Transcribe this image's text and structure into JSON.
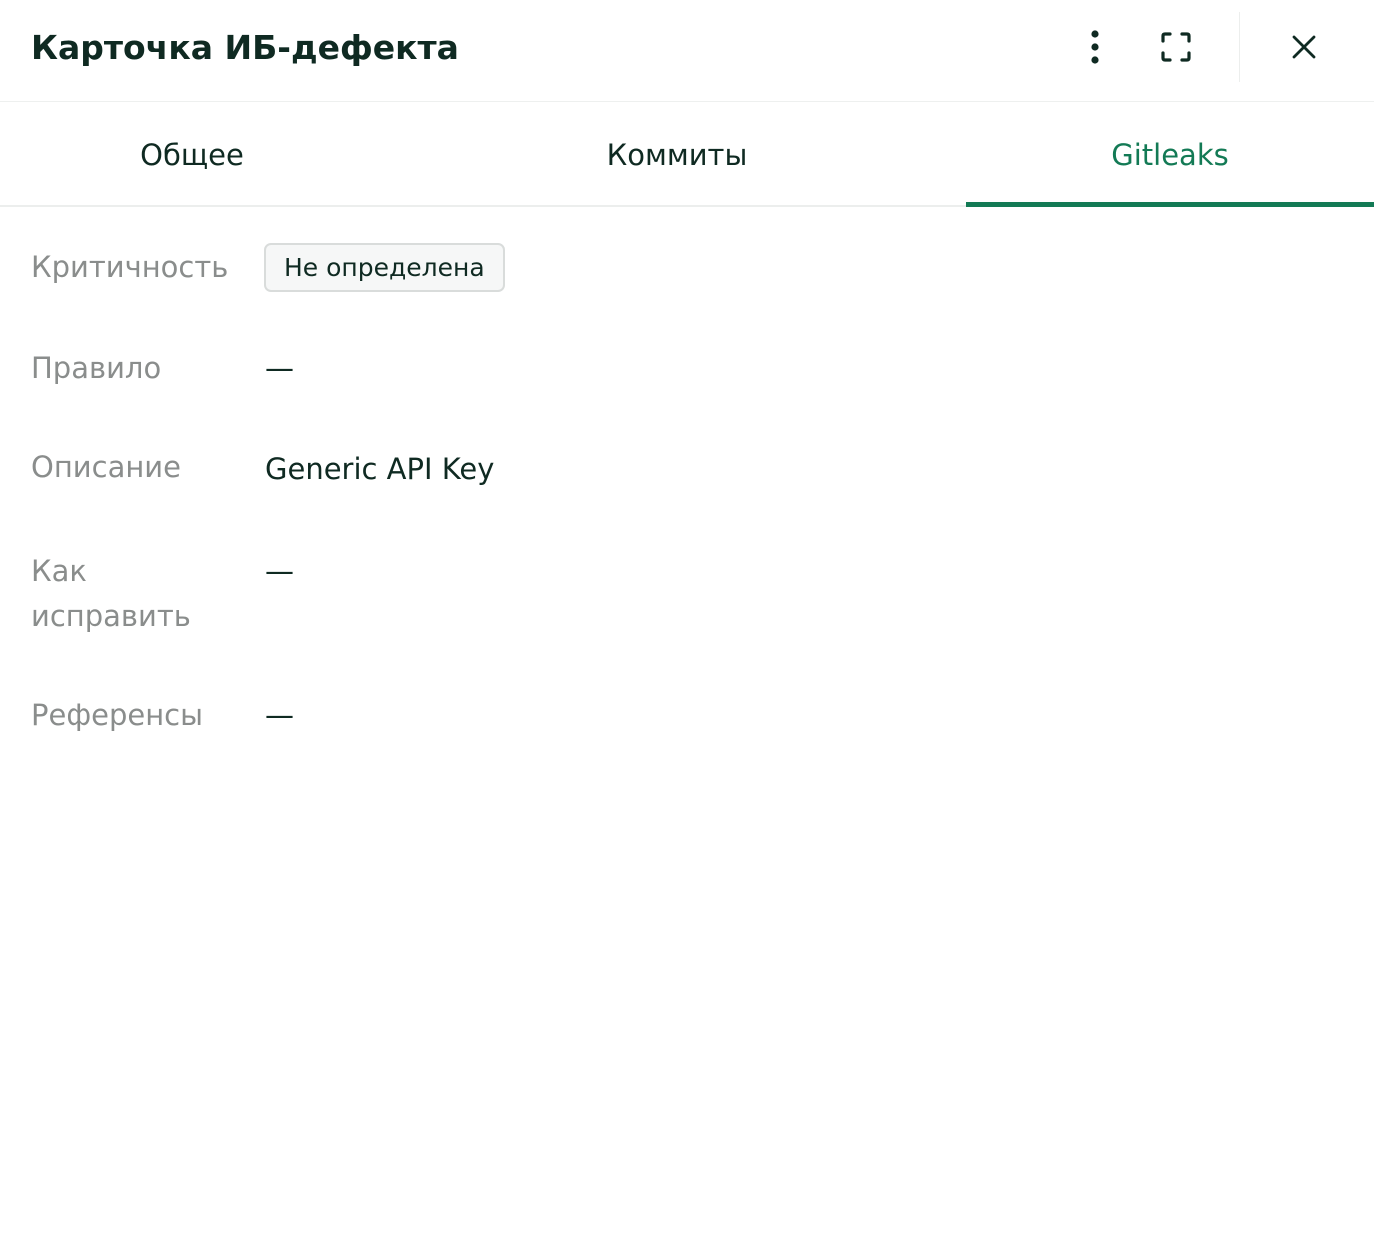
{
  "header": {
    "title": "Карточка ИБ-дефекта",
    "icons": {
      "more": "more-vertical-icon",
      "expand": "fullscreen-icon",
      "close": "close-icon"
    }
  },
  "tabs": [
    {
      "label": "Общее",
      "active": false
    },
    {
      "label": "Коммиты",
      "active": false
    },
    {
      "label": "Gitleaks",
      "active": true
    }
  ],
  "fields": {
    "severity": {
      "label": "Критичность",
      "value": "Не определена"
    },
    "rule": {
      "label": "Правило",
      "value": "—"
    },
    "description": {
      "label": "Описание",
      "value": "Generic API Key"
    },
    "how_to_fix": {
      "label_line1": "Как",
      "label_line2": "исправить",
      "value": "—"
    },
    "references": {
      "label": "Референсы",
      "value": "—"
    }
  },
  "colors": {
    "accent": "#137a55",
    "label": "#8a8d8c",
    "text": "#0f2a22",
    "badge_border": "#d9dcdb"
  }
}
